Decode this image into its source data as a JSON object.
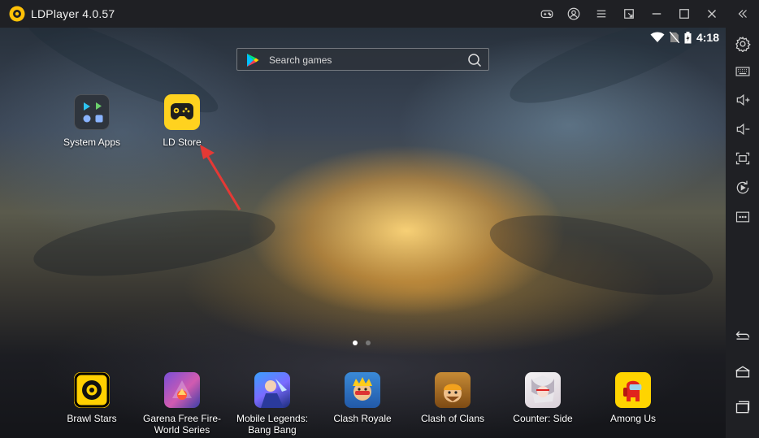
{
  "window": {
    "title": "LDPlayer 4.0.57"
  },
  "titlebar": {
    "buttons": [
      "gamepad-icon",
      "account-icon",
      "menu-icon",
      "resize-icon",
      "minimize-icon",
      "maximize-icon",
      "close-icon",
      "collapse-sidebar-icon"
    ]
  },
  "status": {
    "time": "4:18"
  },
  "search": {
    "placeholder": "Search games"
  },
  "desktop": {
    "system_apps": "System Apps",
    "ld_store": "LD Store"
  },
  "dock": [
    {
      "label": "Brawl Stars"
    },
    {
      "label": "Garena Free Fire-\nWorld Series"
    },
    {
      "label": "Mobile Legends:\nBang Bang"
    },
    {
      "label": "Clash Royale"
    },
    {
      "label": "Clash of Clans"
    },
    {
      "label": "Counter: Side"
    },
    {
      "label": "Among Us"
    }
  ],
  "pages": {
    "count": 2,
    "active": 1
  },
  "sidebar": {
    "tools": [
      "settings-icon",
      "keyboard-icon",
      "volume-up-icon",
      "volume-down-icon",
      "screenshot-icon",
      "rotate-icon",
      "more-icon"
    ],
    "nav": [
      "back-icon",
      "home-icon",
      "recents-icon"
    ]
  },
  "colors": {
    "titlebar": "#1f2024",
    "accent_yellow": "#ffd21f",
    "annotation_red": "#e53935"
  }
}
